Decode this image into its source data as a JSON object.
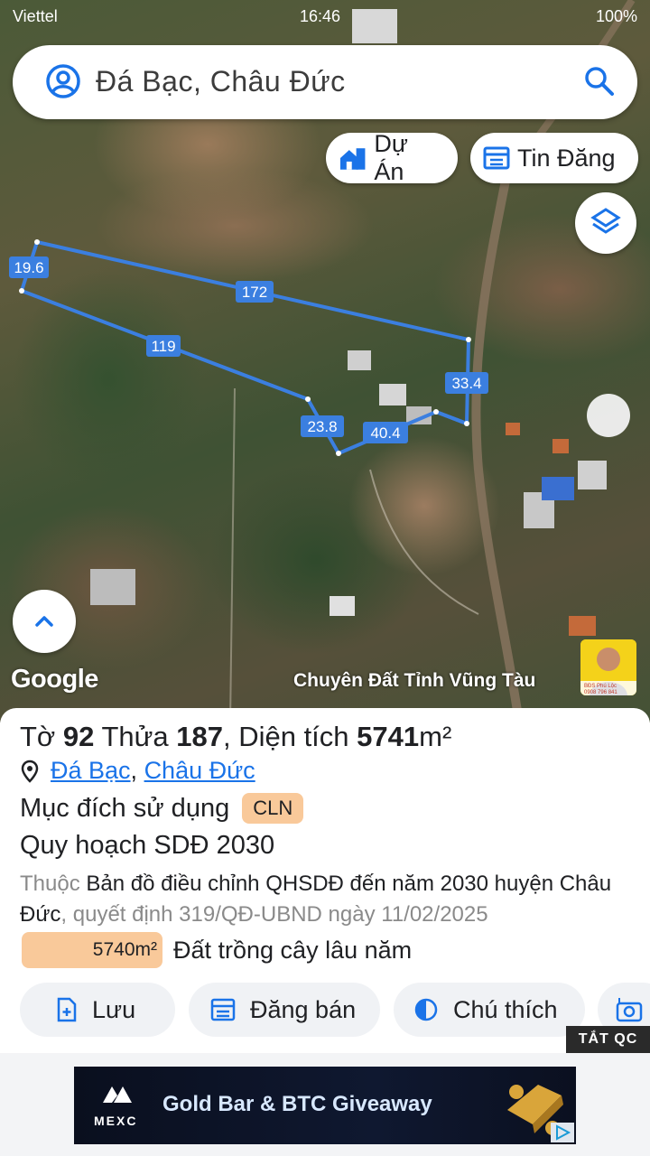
{
  "status_bar": {
    "carrier": "Viettel",
    "time": "16:46",
    "battery": "100%"
  },
  "search": {
    "query": "Đá Bạc, Châu Đức"
  },
  "chips": {
    "du_an": "Dự Án",
    "tin_dang": "Tin Đăng"
  },
  "map": {
    "measurements": [
      "19.6",
      "172",
      "119",
      "33.4",
      "23.8",
      "40.4"
    ],
    "google_logo": "Google",
    "credit": "Chuyên Đất Tỉnh Vũng Tàu",
    "avatar_line1": "BĐS Phú Lộc",
    "avatar_line2": "0908 796 841",
    "parcel_color": "#3b7fe0"
  },
  "parcel": {
    "to_label": "Tờ",
    "to_value": "92",
    "thua_label": "Thửa",
    "thua_value": "187",
    "dientich_label": ", Diện tích",
    "dientich_value": "5741",
    "unit": "m²",
    "location_a": "Đá Bạc",
    "location_sep": ", ",
    "location_b": "Châu Đức",
    "purpose_label": "Mục đích sử dụng",
    "purpose_code": "CLN",
    "plan_label": "Quy hoạch SDĐ 2030",
    "desc_prefix": "Thuộc",
    "desc_main": "Bản đồ điều chỉnh QHSDĐ đến năm 2030 huyện Châu Đức",
    "desc_suffix": ", quyết định 319/QĐ-UBND ngày 11/02/2025",
    "area_value": "5740m²",
    "area_text": "Đất trồng cây lâu năm"
  },
  "actions": {
    "save": "Lưu",
    "sell": "Đăng bán",
    "legend": "Chú thích"
  },
  "ad": {
    "close": "TẮT QC",
    "brand": "MEXC",
    "headline": "Gold Bar & BTC Giveaway"
  },
  "colors": {
    "accent": "#1a73e8",
    "badge": "#f9c99a"
  }
}
